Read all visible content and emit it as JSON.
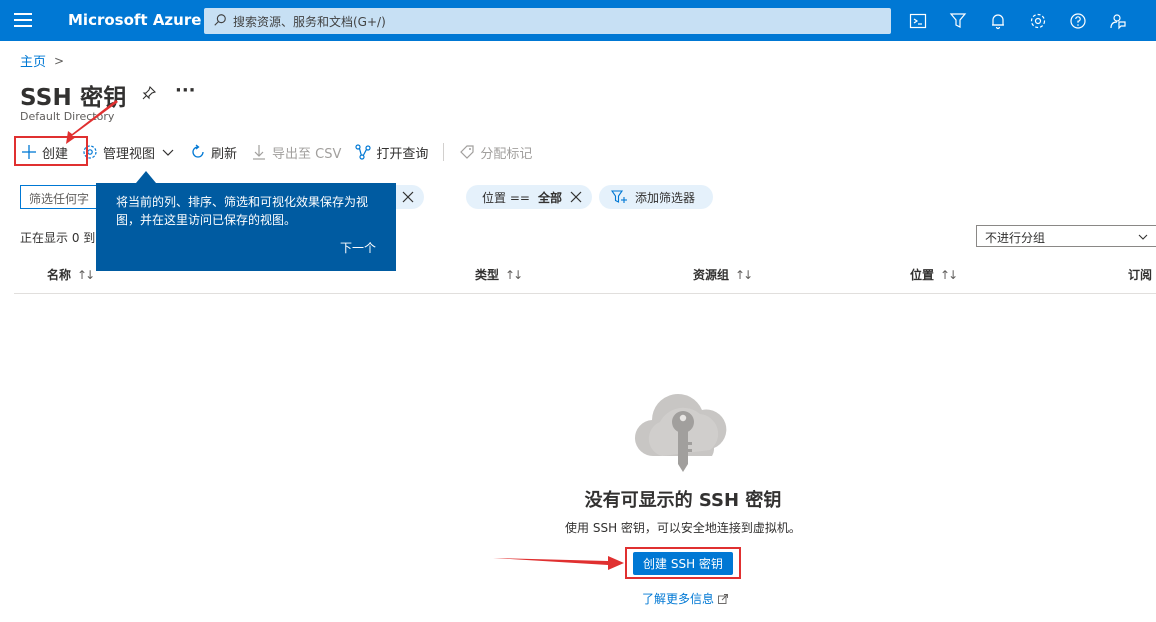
{
  "topbar": {
    "brand": "Microsoft Azure",
    "search_placeholder": "搜索资源、服务和文档(G+/)",
    "icons": [
      "cloud-shell-icon",
      "directory-filter-icon",
      "notifications-icon",
      "settings-icon",
      "help-icon",
      "feedback-icon"
    ]
  },
  "breadcrumb": {
    "home": "主页",
    "separator": ">"
  },
  "page": {
    "title": "SSH 密钥",
    "subtitle": "Default Directory",
    "more": "···"
  },
  "toolbar": {
    "create": "创建",
    "manage_view": "管理视图",
    "refresh": "刷新",
    "export_csv": "导出至 CSV",
    "open_query": "打开查询",
    "assign_tags": "分配标记"
  },
  "filters": {
    "filter_placeholder": "筛选任何字",
    "pill1_value": "全部",
    "pill2_label": "位置 ==",
    "pill2_value": "全部",
    "add_filter": "添加筛选器"
  },
  "showing": "正在显示 0 到",
  "groupby": "不进行分组",
  "columns": [
    "名称",
    "类型",
    "资源组",
    "位置",
    "订阅"
  ],
  "sort_glyph": "↑↓",
  "teaching_bubble": {
    "text": "将当前的列、排序、筛选和可视化效果保存为视图，并在这里访问已保存的视图。",
    "next": "下一个"
  },
  "empty_state": {
    "title": "没有可显示的 SSH 密钥",
    "subtitle": "使用 SSH 密钥，可以安全地连接到虚拟机。",
    "create_button": "创建 SSH 密钥",
    "learn_more": "了解更多信息"
  },
  "colors": {
    "accent": "#0078d4",
    "bubble": "#005ba1",
    "annotation_red": "#e03030"
  }
}
